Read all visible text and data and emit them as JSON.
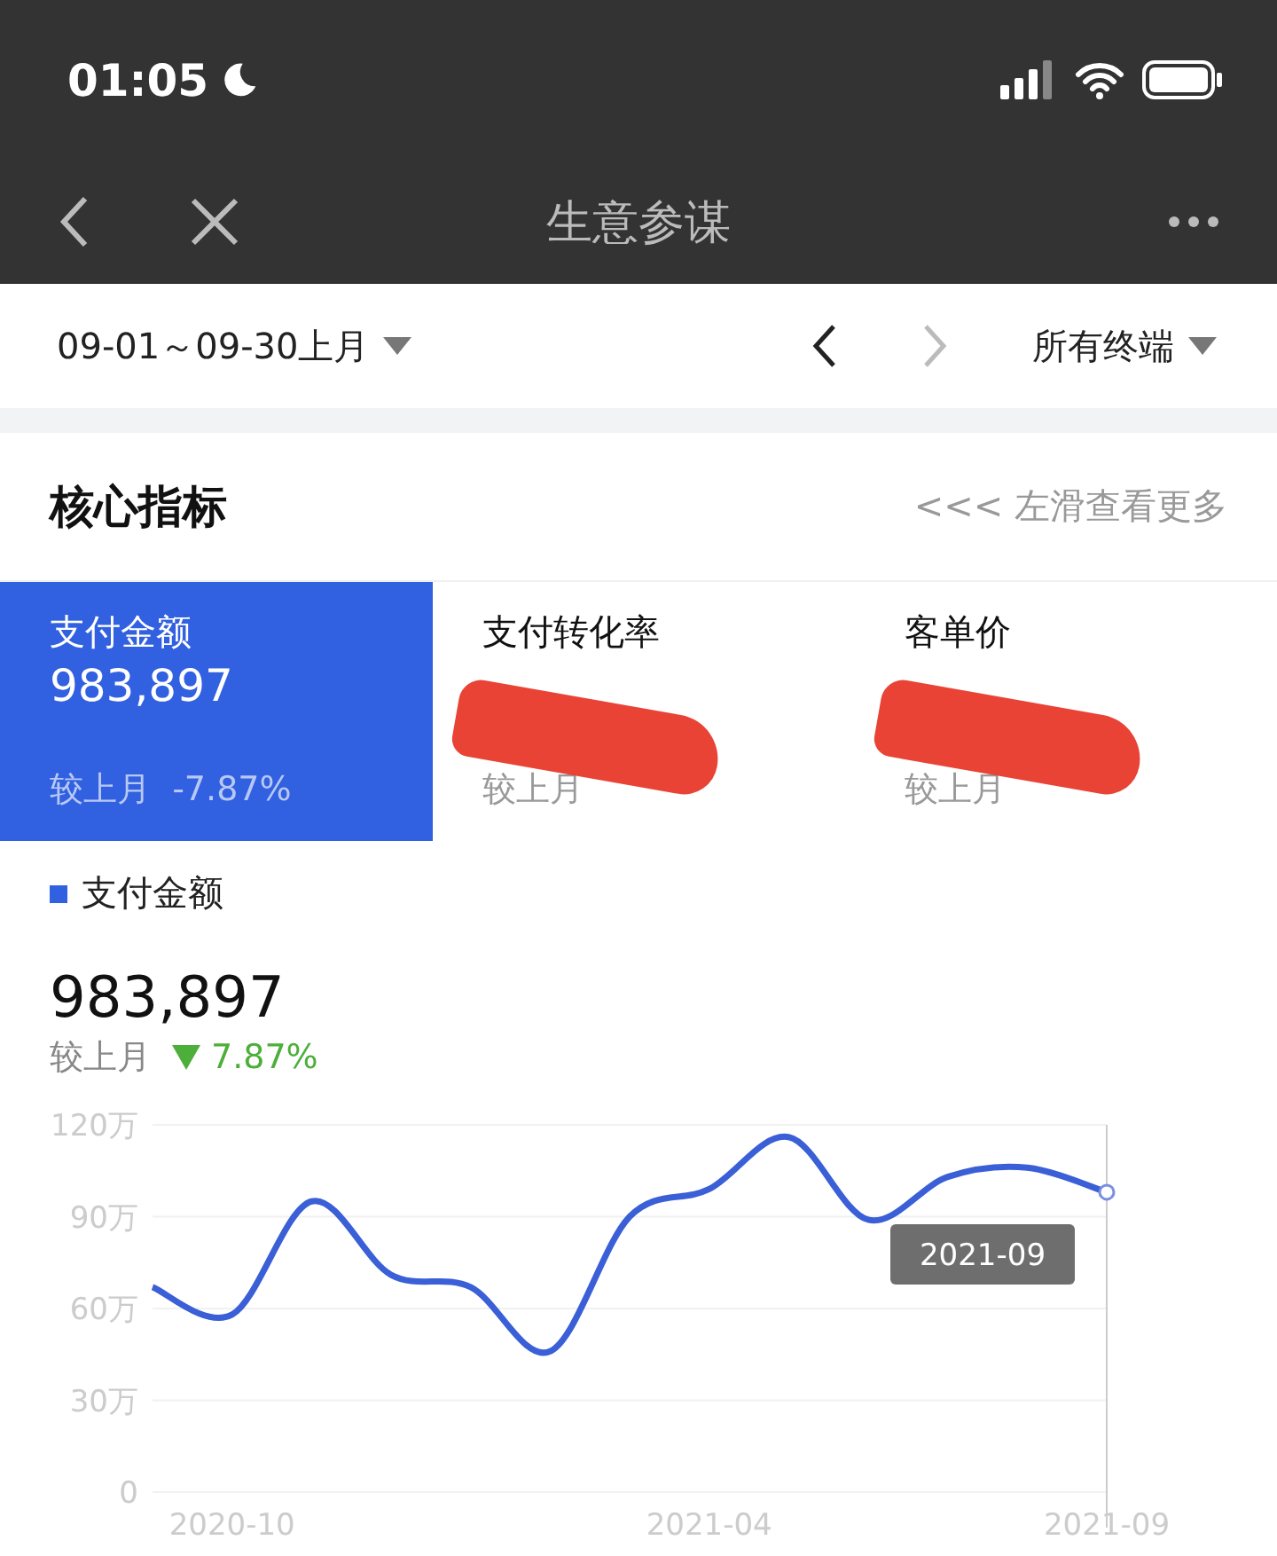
{
  "status_bar": {
    "time": "01:05"
  },
  "nav": {
    "title": "生意参谋"
  },
  "filter": {
    "date_range": "09-01～09-30上月",
    "terminal": "所有终端"
  },
  "section": {
    "title": "核心指标",
    "hint": "<<< 左滑查看更多"
  },
  "metrics": [
    {
      "title": "支付金额",
      "value": "983,897",
      "compare": "较上月  -7.87%",
      "selected": true,
      "redacted": false
    },
    {
      "title": "支付转化率",
      "compare": "较上月",
      "selected": false,
      "redacted": true
    },
    {
      "title": "客单价",
      "compare": "较上月",
      "selected": false,
      "redacted": true
    }
  ],
  "detail": {
    "value": "983,897",
    "compare_label": "较上月",
    "change": "7.87%",
    "down": true
  },
  "chart_tooltip": "2021-09",
  "chart_data": {
    "type": "line",
    "categories": [
      null,
      "2020-10",
      null,
      null,
      null,
      null,
      null,
      "2021-04",
      null,
      null,
      null,
      null,
      "2021-09"
    ],
    "grid": true,
    "series": [
      {
        "name": "支付金额",
        "color": "#3a5fd6",
        "values": [
          67,
          58,
          95,
          71,
          67,
          46,
          90,
          99,
          116,
          89,
          103,
          106,
          98
        ]
      }
    ],
    "ylim": [
      0,
      120
    ],
    "yticks": [
      {
        "value": 0,
        "label": "0"
      },
      {
        "value": 30,
        "label": "30万"
      },
      {
        "value": 60,
        "label": "60万"
      },
      {
        "value": 90,
        "label": "90万"
      },
      {
        "value": 120,
        "label": "120万"
      }
    ]
  }
}
